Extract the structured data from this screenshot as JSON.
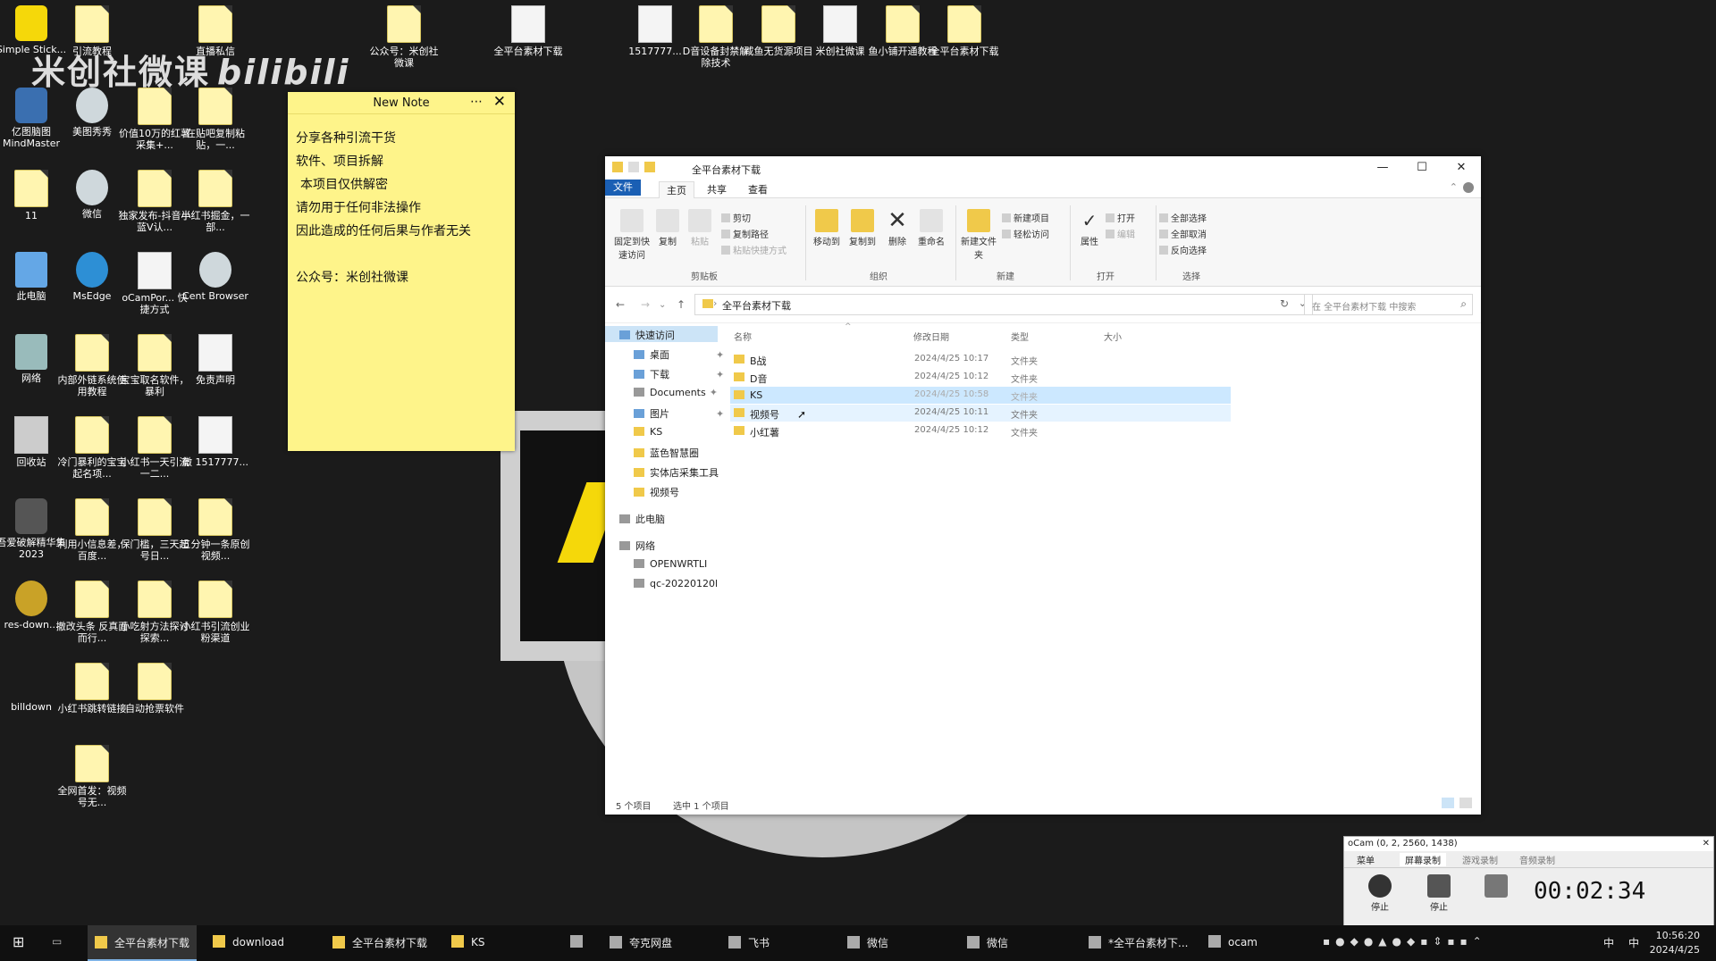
{
  "watermark": {
    "text": "米创社微课",
    "brand": "bilibili"
  },
  "desktop_icons": [
    {
      "label": "Simple Stick..."
    },
    {
      "label": "引流教程"
    },
    {
      "label": "直播私信"
    },
    {
      "label": "公众号：米创社微课"
    },
    {
      "label": "全平台素材下载"
    },
    {
      "label": "1517777..."
    },
    {
      "label": "D音设备封禁解除技术"
    },
    {
      "label": "咸鱼无货源项目"
    },
    {
      "label": "米创社微课"
    },
    {
      "label": "鱼小铺开通教程"
    },
    {
      "label": "全平台素材下载"
    },
    {
      "label": "亿图脑图 MindMaster"
    },
    {
      "label": "美图秀秀"
    },
    {
      "label": "价值10万的红薯采集+..."
    },
    {
      "label": "在贴吧复制粘贴，一..."
    },
    {
      "label": "11"
    },
    {
      "label": "微信"
    },
    {
      "label": "独家发布-抖音半蓝V认..."
    },
    {
      "label": "小红书掘金，一部..."
    },
    {
      "label": "此电脑"
    },
    {
      "label": "MsEdge"
    },
    {
      "label": "oCamPor... 快捷方式"
    },
    {
      "label": "Cent Browser"
    },
    {
      "label": "网络"
    },
    {
      "label": "内部外链系统使用教程"
    },
    {
      "label": "宝宝取名软件，暴利"
    },
    {
      "label": "免责声明"
    },
    {
      "label": "回收站"
    },
    {
      "label": "冷门暴利的宝宝起名项..."
    },
    {
      "label": "小红书一天引流一二..."
    },
    {
      "label": "微 1517777..."
    },
    {
      "label": "吾爱破解精华集 2023"
    },
    {
      "label": "利用小信息差，百度..."
    },
    {
      "label": "保门槛，三天起号日..."
    },
    {
      "label": "五分钟一条原创视频..."
    },
    {
      "label": "res-down..."
    },
    {
      "label": "撤改头条 反真面而行..."
    },
    {
      "label": "小吃射方法探讨探索..."
    },
    {
      "label": "小红书引流创业粉渠道"
    },
    {
      "label": "billdown"
    },
    {
      "label": "小红书跳转链接"
    },
    {
      "label": "自动抢票软件"
    },
    {
      "label": "全网首发：视频号无..."
    }
  ],
  "note": {
    "title": "New Note",
    "more": "⋯",
    "close": "✕",
    "lines": [
      "分享各种引流干货",
      "软件、项目拆解",
      "本项目仅供解密",
      "请勿用于任何非法操作",
      "因此造成的任何后果与作者无关",
      "",
      "公众号：米创社微课"
    ]
  },
  "explorer": {
    "title": "全平台素材下载",
    "tabs": [
      "文件",
      "主页",
      "共享",
      "查看"
    ],
    "ribbon": {
      "clipboard": {
        "group": "剪贴板",
        "pin": "固定到快速访问",
        "copy": "复制",
        "paste": "粘贴",
        "cut": "剪切",
        "copy_path": "复制路径",
        "paste_shortcut": "粘贴快捷方式"
      },
      "organize": {
        "group": "组织",
        "move_to": "移动到",
        "copy_to": "复制到",
        "delete": "删除",
        "rename": "重命名"
      },
      "new": {
        "group": "新建",
        "new_folder": "新建文件夹",
        "new_item": "新建项目",
        "easy_access": "轻松访问"
      },
      "open": {
        "group": "打开",
        "properties": "属性",
        "open": "打开",
        "edit": "编辑"
      },
      "select": {
        "group": "选择",
        "all": "全部选择",
        "none": "全部取消",
        "invert": "反向选择"
      }
    },
    "address": "全平台素材下载",
    "search_placeholder": "在 全平台素材下载 中搜索",
    "nav": [
      "快速访问",
      "桌面",
      "下载",
      "Documents",
      "图片",
      "KS",
      "蓝色智慧圈",
      "实体店采集工具",
      "视频号",
      "此电脑",
      "网络",
      "OPENWRTLI",
      "qc-20220120l"
    ],
    "columns": [
      "名称",
      "修改日期",
      "类型",
      "大小"
    ],
    "files": [
      {
        "name": "B战",
        "date": "2024/4/25 10:17",
        "type": "文件夹"
      },
      {
        "name": "D音",
        "date": "2024/4/25 10:12",
        "type": "文件夹"
      },
      {
        "name": "KS",
        "date": "2024/4/25 10:58",
        "type": "文件夹"
      },
      {
        "name": "视频号",
        "date": "2024/4/25 10:11",
        "type": "文件夹"
      },
      {
        "name": "小红薯",
        "date": "2024/4/25 10:12",
        "type": "文件夹"
      }
    ],
    "status": {
      "count": "5 个项目",
      "selected": "选中 1 个项目"
    }
  },
  "ocam": {
    "title": "oCam (0, 2, 2560, 1438)",
    "tabs": [
      "菜单",
      "屏幕录制",
      "游戏录制",
      "音频录制"
    ],
    "stop": "停止",
    "pause": "停止",
    "time": "00:02:34"
  },
  "taskbar": {
    "items": [
      "全平台素材下载",
      "download",
      "全平台素材下载",
      "KS",
      "夸克网盘",
      "飞书",
      "微信",
      "微信",
      "*全平台素材下...",
      "ocam"
    ],
    "tray": {
      "ime1": "中",
      "ime2": "中"
    },
    "time": "10:56:20",
    "date": "2024/4/25"
  }
}
